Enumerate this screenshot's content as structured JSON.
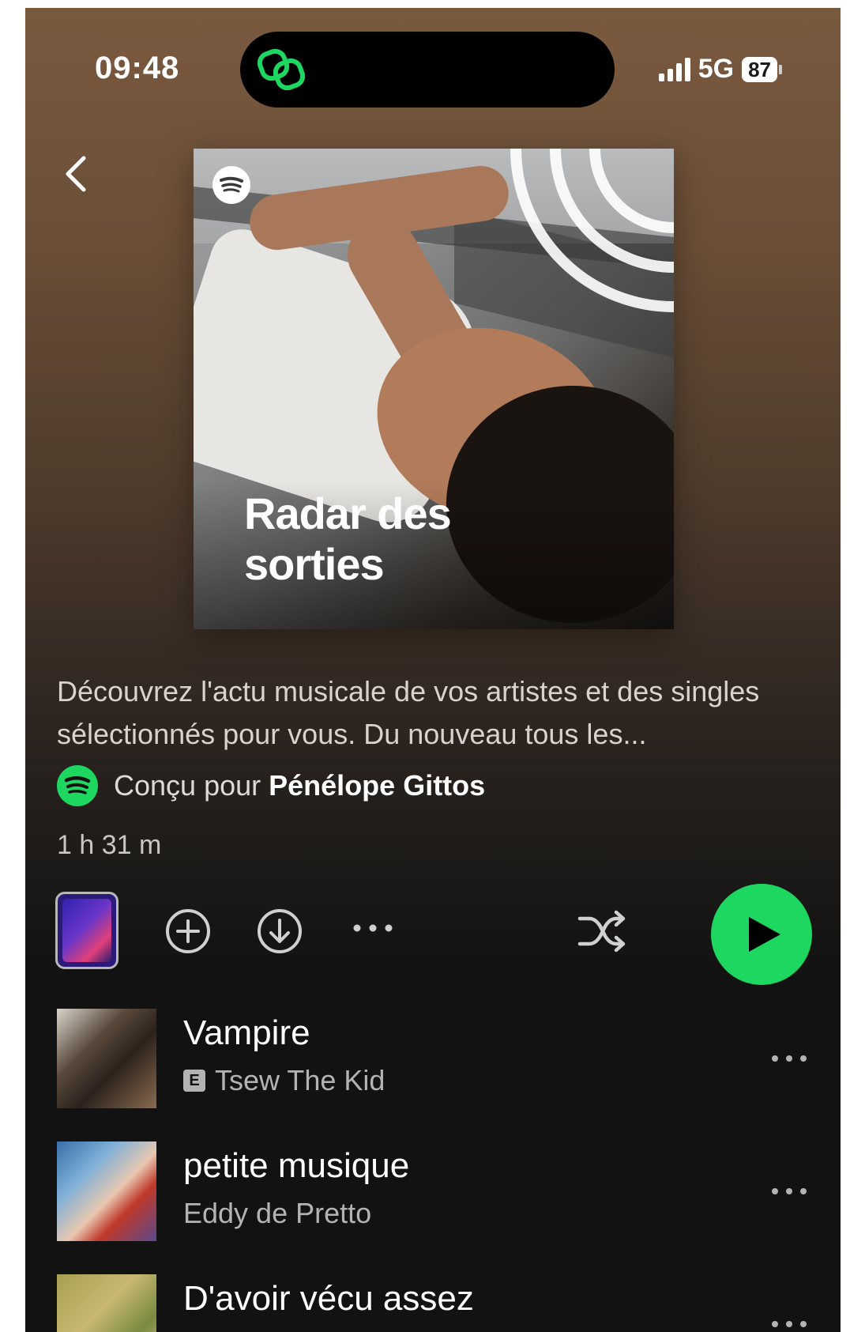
{
  "status_bar": {
    "time": "09:48",
    "network": "5G",
    "battery": "87"
  },
  "playlist": {
    "cover_title": "Radar des sorties",
    "description": "Découvrez l'actu musicale de vos artistes et des singles sélectionnés pour vous. Du nouveau tous les...",
    "made_for_prefix": "Conçu pour",
    "made_for_user": "Pénélope Gittos",
    "duration": "1 h 31 m"
  },
  "tracks": [
    {
      "title": "Vampire",
      "artist": "Tsew The Kid",
      "explicit": true,
      "explicit_label": "E"
    },
    {
      "title": "petite musique",
      "artist": "Eddy de Pretto",
      "explicit": false
    },
    {
      "title": "D'avoir vécu assez",
      "artist": "",
      "explicit": false
    }
  ],
  "colors": {
    "accent": "#1ed760",
    "background": "#121212",
    "header_gradient": "#7a5a3f",
    "secondary_text": "#b3b3b3"
  },
  "icons": [
    "back-chevron-icon",
    "spotify-icon",
    "add-circle-icon",
    "download-icon",
    "more-icon",
    "shuffle-icon",
    "play-icon",
    "link-icon"
  ]
}
